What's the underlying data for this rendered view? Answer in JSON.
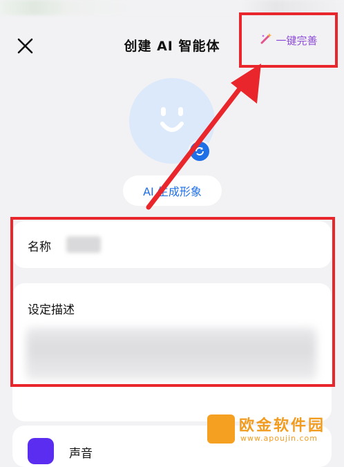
{
  "header": {
    "title": "创建 AI 智能体",
    "polish_label": "一键完善",
    "close_icon": "close-icon",
    "polish_icon": "magic-wand-icon"
  },
  "avatar": {
    "icon": "smiley-face-icon",
    "edit_icon": "refresh-icon",
    "generate_label": "AI 生成形象"
  },
  "form": {
    "name_label": "名称",
    "desc_label": "设定描述"
  },
  "next_card": {
    "label": "声音"
  },
  "watermark": {
    "text": "欧金软件园",
    "url": "www.apoujin.com"
  },
  "colors": {
    "accent": "#1f6fe6",
    "annotation_red": "#e8262b",
    "polish_purple": "#8e4dd6",
    "watermark_orange": "#f29c1f"
  }
}
